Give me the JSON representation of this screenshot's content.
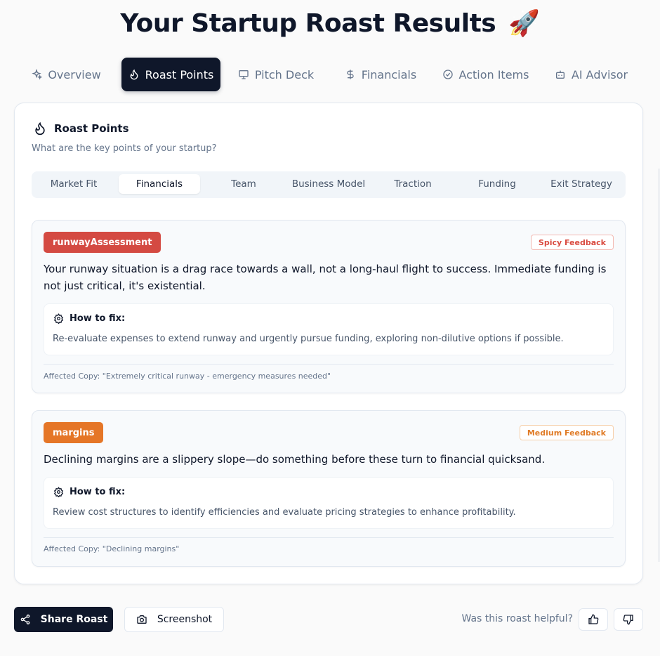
{
  "page": {
    "title": "Your Startup Roast Results",
    "title_emoji": "🚀"
  },
  "main_tabs": [
    {
      "label": "Overview",
      "icon": "sparkles-icon"
    },
    {
      "label": "Roast Points",
      "icon": "flame-icon",
      "active": true
    },
    {
      "label": "Pitch Deck",
      "icon": "presentation-icon"
    },
    {
      "label": "Financials",
      "icon": "dollar-icon"
    },
    {
      "label": "Action Items",
      "icon": "check-circle-icon"
    },
    {
      "label": "AI Advisor",
      "icon": "bot-icon"
    }
  ],
  "card": {
    "title": "Roast Points",
    "subtitle": "What are the key points of your startup?",
    "sub_tabs": [
      {
        "label": "Market Fit"
      },
      {
        "label": "Financials",
        "active": true
      },
      {
        "label": "Team"
      },
      {
        "label": "Business Model"
      },
      {
        "label": "Traction"
      },
      {
        "label": "Funding"
      },
      {
        "label": "Exit Strategy"
      }
    ],
    "points": [
      {
        "tag": "runwayAssessment",
        "tag_color": "#d44a42",
        "badge": "Spicy Feedback",
        "badge_color": "#d94a3f",
        "text": "Your runway situation is a drag race towards a wall, not a long-haul flight to success. Immediate funding is not just critical, it's existential.",
        "fix_title": "How to fix:",
        "fix_text": "Re-evaluate expenses to extend runway and urgently pursue funding, exploring non-dilutive options if possible.",
        "affected_label": "Affected Copy:",
        "affected_text": "\"Extremely critical runway - emergency measures needed\""
      },
      {
        "tag": "margins",
        "tag_color": "#e57627",
        "badge": "Medium Feedback",
        "badge_color": "#e07b26",
        "text": "Declining margins are a slippery slope—do something before these turn to financial quicksand.",
        "fix_title": "How to fix:",
        "fix_text": "Review cost structures to identify efficiencies and evaluate pricing strategies to enhance profitability.",
        "affected_label": "Affected Copy:",
        "affected_text": "\"Declining margins\""
      }
    ]
  },
  "footer": {
    "share_label": "Share Roast",
    "screenshot_label": "Screenshot",
    "helpful_text": "Was this roast helpful?"
  }
}
